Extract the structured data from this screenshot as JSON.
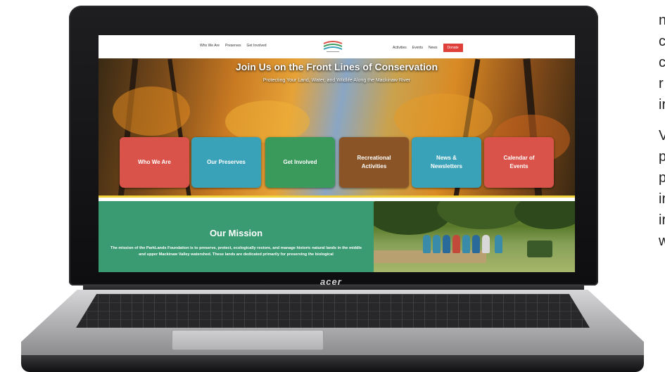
{
  "laptop": {
    "brand": "acer"
  },
  "nav": {
    "left_items": [
      "Who We Are",
      "Preserves",
      "Get Involved"
    ],
    "right_items": [
      "Activities",
      "Events",
      "News"
    ],
    "donate": "Donate",
    "logo_icon": "parklands-logo-icon"
  },
  "hero": {
    "title": "Join Us on the Front Lines of Conservation",
    "subtitle": "Protecting Your Land, Water, and Wildlife Along the Mackinaw River",
    "tiles": [
      {
        "label": "Who We Are",
        "color": "#d9534a"
      },
      {
        "label": "Our Preserves",
        "color": "#3aa2b8"
      },
      {
        "label": "Get Involved",
        "color": "#3a9a5c"
      },
      {
        "label": "Recreational Activities",
        "color": "#8a5426"
      },
      {
        "label": "News & Newsletters",
        "color": "#3aa2b8"
      },
      {
        "label": "Calendar of Events",
        "color": "#d9534a"
      }
    ],
    "accent_line_color": "#f1d23b"
  },
  "mission": {
    "heading": "Our Mission",
    "body": "The mission of the ParkLands Foundation is to preserve, protect, ecologically restore, and manage historic natural lands in the middle and upper Mackinaw Valley watershed. These lands are dedicated primarily for preserving the biological"
  },
  "side_text": {
    "block1": [
      "n",
      "c",
      "c",
      "r",
      "ir"
    ],
    "block2": [
      "V",
      "p",
      "p",
      "ir",
      "ir",
      "w"
    ]
  }
}
